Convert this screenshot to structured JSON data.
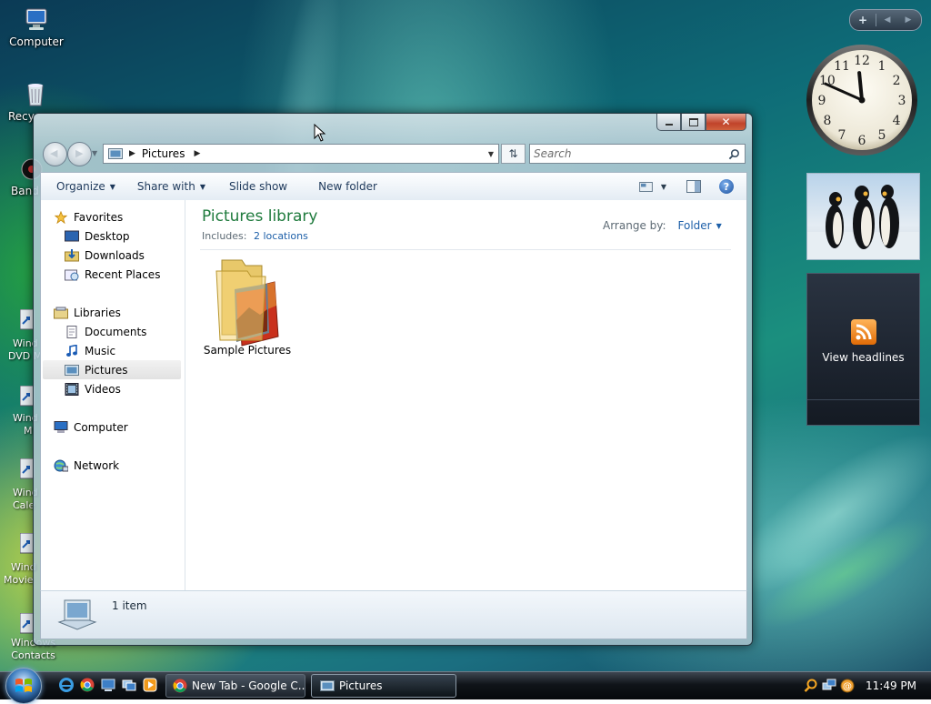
{
  "desktop": {
    "icons": [
      {
        "label": "Computer"
      },
      {
        "label": "Recy"
      },
      {
        "label": "Band"
      }
    ],
    "shortcut_fragments": [
      {
        "line1": "Wind",
        "line2": "DVD M"
      },
      {
        "line1": "Wind",
        "line2": "M"
      },
      {
        "line1": "Wind",
        "line2": "Cale"
      },
      {
        "line1": "Wind",
        "line2": "Movie"
      },
      {
        "line1": "Windows",
        "line2": "Contacts"
      }
    ]
  },
  "window": {
    "address": {
      "segment": "Pictures"
    },
    "search": {
      "placeholder": "Search"
    },
    "toolbar": {
      "organize": "Organize",
      "share_with": "Share with",
      "slide_show": "Slide show",
      "new_folder": "New folder"
    },
    "nav": {
      "favorites": "Favorites",
      "desktop": "Desktop",
      "downloads": "Downloads",
      "recent_places": "Recent Places",
      "libraries": "Libraries",
      "documents": "Documents",
      "music": "Music",
      "pictures": "Pictures",
      "videos": "Videos",
      "computer": "Computer",
      "network": "Network"
    },
    "library": {
      "title": "Pictures library",
      "includes_label": "Includes:",
      "includes_link": "2 locations",
      "arrange_label": "Arrange by:",
      "arrange_value": "Folder"
    },
    "items": [
      {
        "name": "Sample Pictures"
      }
    ],
    "status": {
      "count": "1 item"
    }
  },
  "gadgets": {
    "clock": {
      "hour": 11,
      "minute": 49
    },
    "feed": {
      "label": "View headlines"
    }
  },
  "taskbar": {
    "buttons": [
      {
        "label": "New Tab - Google C..."
      },
      {
        "label": "Pictures"
      }
    ],
    "time": "11:49 PM"
  },
  "colors": {
    "title_green": "#1e7a3c",
    "link_blue": "#1d5fa8",
    "toolbar_text": "#1e395b"
  }
}
